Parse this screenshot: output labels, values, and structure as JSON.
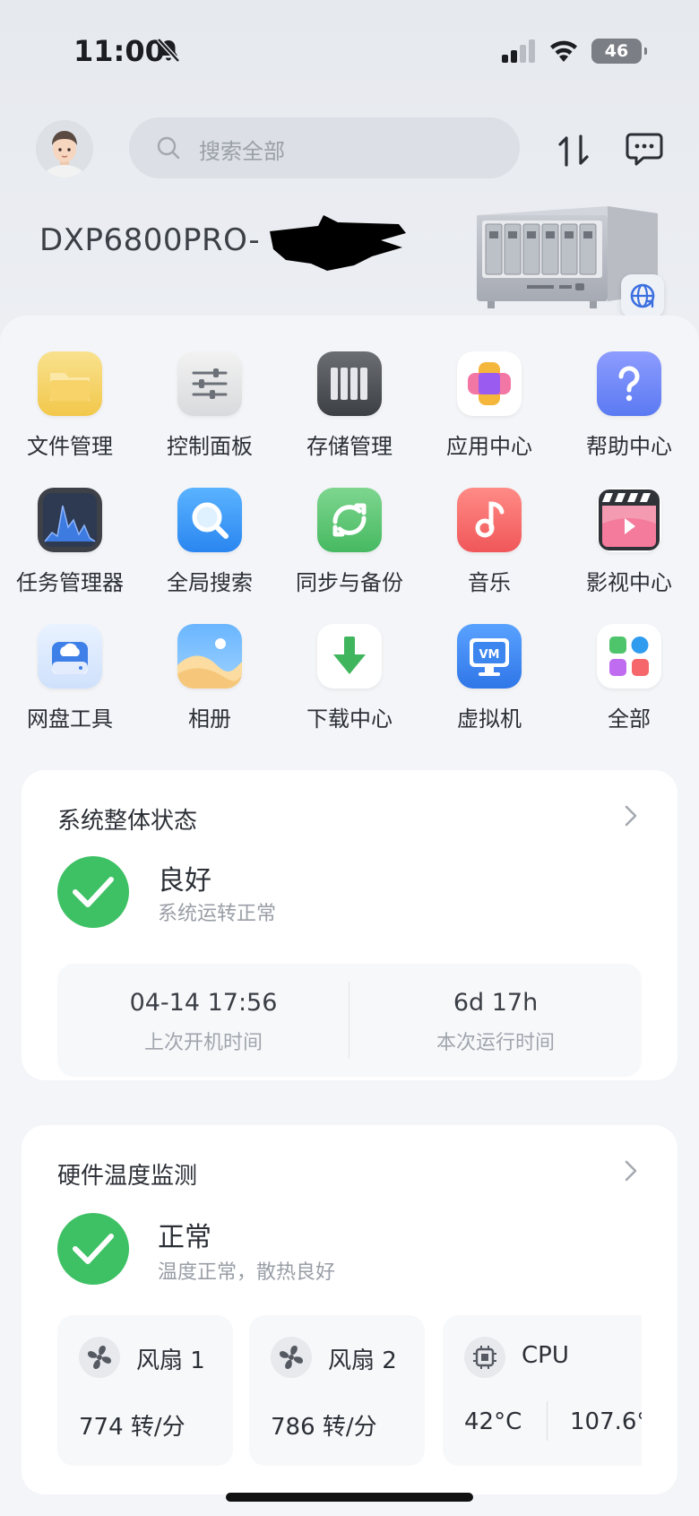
{
  "status_bar": {
    "time": "11:00",
    "battery": "46"
  },
  "header": {
    "search_placeholder": "搜索全部",
    "device_name": "DXP6800PRO-"
  },
  "apps": [
    {
      "label": "文件管理",
      "icon": "folder-icon"
    },
    {
      "label": "控制面板",
      "icon": "control-panel-icon"
    },
    {
      "label": "存储管理",
      "icon": "storage-icon"
    },
    {
      "label": "应用中心",
      "icon": "app-center-icon"
    },
    {
      "label": "帮助中心",
      "icon": "help-icon"
    },
    {
      "label": "任务管理器",
      "icon": "task-manager-icon"
    },
    {
      "label": "全局搜索",
      "icon": "global-search-icon"
    },
    {
      "label": "同步与备份",
      "icon": "sync-backup-icon"
    },
    {
      "label": "音乐",
      "icon": "music-icon"
    },
    {
      "label": "影视中心",
      "icon": "video-center-icon"
    },
    {
      "label": "网盘工具",
      "icon": "cloud-drive-icon"
    },
    {
      "label": "相册",
      "icon": "photo-album-icon"
    },
    {
      "label": "下载中心",
      "icon": "download-icon"
    },
    {
      "label": "虚拟机",
      "icon": "vm-icon"
    },
    {
      "label": "全部",
      "icon": "all-apps-icon"
    }
  ],
  "system_status": {
    "title": "系统整体状态",
    "state": "良好",
    "description": "系统运转正常",
    "last_boot_value": "04-14 17:56",
    "last_boot_label": "上次开机时间",
    "uptime_value": "6d 17h",
    "uptime_label": "本次运行时间"
  },
  "hardware_temp": {
    "title": "硬件温度监测",
    "state": "正常",
    "description": "温度正常，散热良好",
    "items": [
      {
        "name": "风扇 1",
        "value": "774 转/分"
      },
      {
        "name": "风扇 2",
        "value": "786 转/分"
      },
      {
        "name": "CPU",
        "value": "42°C",
        "value2": "107.6°"
      }
    ]
  },
  "colors": {
    "ok_green": "#3ec164",
    "card_bg": "#ffffff"
  }
}
